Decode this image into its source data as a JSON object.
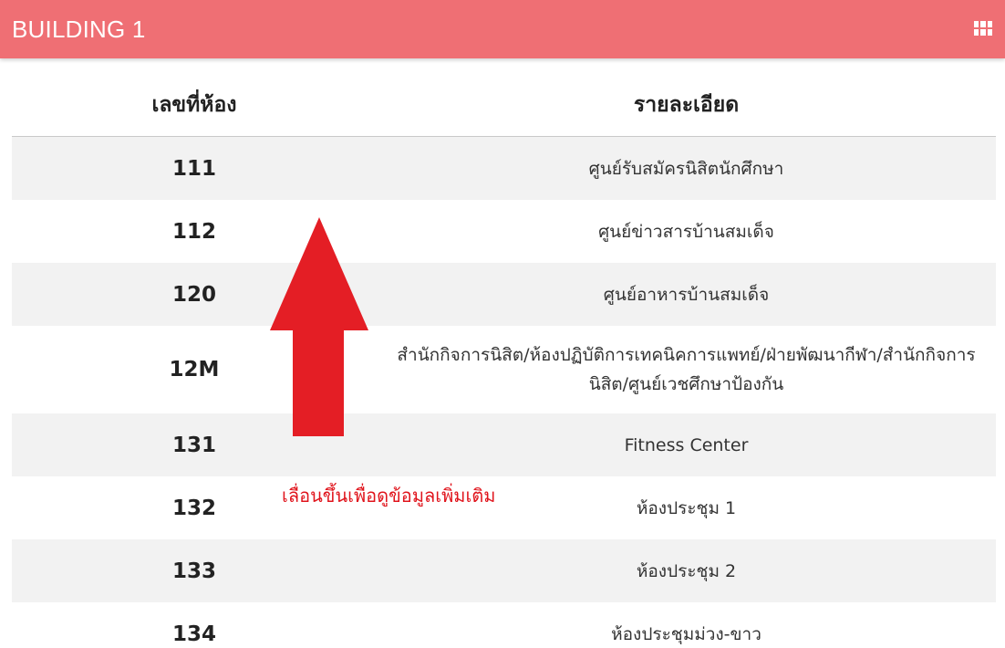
{
  "header": {
    "title": "BUILDING 1",
    "menu_icon": "grid-icon"
  },
  "table": {
    "columns": {
      "room": "เลขที่ห้อง",
      "description": "รายละเอียด"
    },
    "rows": [
      {
        "room": "111",
        "description": "ศูนย์รับสมัครนิสิตนักศึกษา"
      },
      {
        "room": "112",
        "description": "ศูนย์ข่าวสารบ้านสมเด็จ"
      },
      {
        "room": "120",
        "description": "ศูนย์อาหารบ้านสมเด็จ"
      },
      {
        "room": "12M",
        "description": "สำนักกิจการนิสิต/ห้องปฏิบัติการเทคนิคการแพทย์/ฝ่ายพัฒนากีฬา/สำนักกิจการนิสิต/ศูนย์เวชศึกษาป้องกัน"
      },
      {
        "room": "131",
        "description": "Fitness Center"
      },
      {
        "room": "132",
        "description": "ห้องประชุม 1"
      },
      {
        "room": "133",
        "description": "ห้องประชุม 2"
      },
      {
        "room": "134",
        "description": "ห้องประชุมม่วง-ขาว"
      }
    ]
  },
  "overlay": {
    "hint": "เลื่อนขึ้นเพื่อดูข้อมูลเพิ่มเติม",
    "arrow_icon": "arrow-up-icon"
  },
  "colors": {
    "header_bg": "#ef6f74",
    "arrow": "#e41e25",
    "hint_text": "#e0141c",
    "row_stripe": "#f2f2f2"
  }
}
